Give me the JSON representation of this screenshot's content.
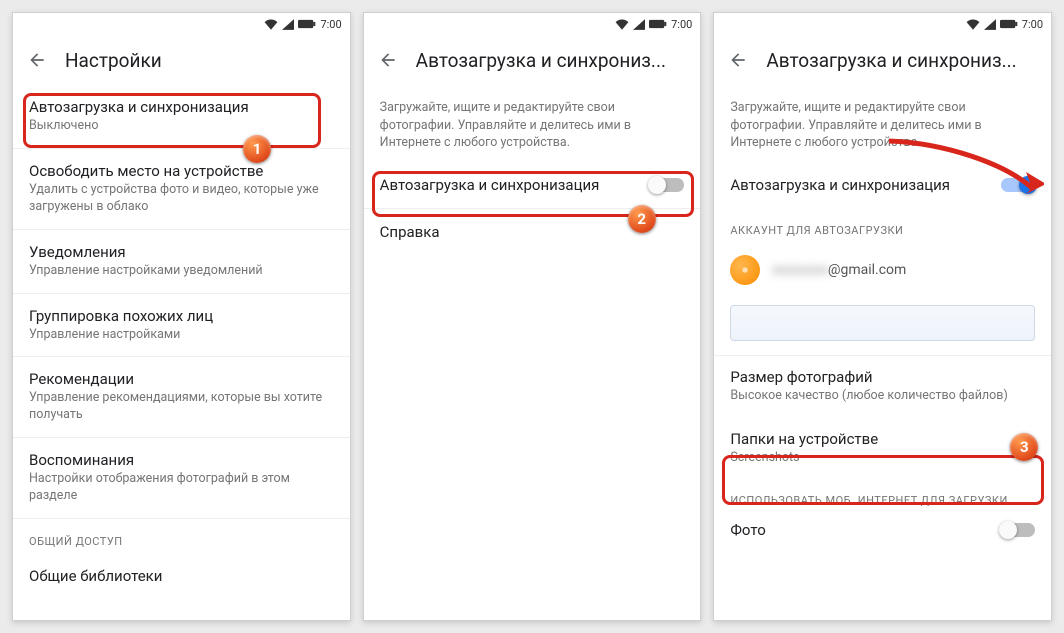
{
  "status": {
    "time": "7:00"
  },
  "screen1": {
    "title": "Настройки",
    "items": [
      {
        "primary": "Автозагрузка и синхронизация",
        "secondary": "Выключено"
      },
      {
        "primary": "Освободить место на устройстве",
        "secondary": "Удалить с устройства фото и видео, которые уже загружены в облако"
      },
      {
        "primary": "Уведомления",
        "secondary": "Управление настройками уведомлений"
      },
      {
        "primary": "Группировка похожих лиц",
        "secondary": "Управление настройками"
      },
      {
        "primary": "Рекомендации",
        "secondary": "Управление рекомендациями, которые вы хотите получать"
      },
      {
        "primary": "Воспоминания",
        "secondary": "Настройки отображения фотографий в этом разделе"
      }
    ],
    "section": "ОБЩИЙ ДОСТУП",
    "shared": "Общие библиотеки"
  },
  "screen2": {
    "title": "Автозагрузка и синхрониз...",
    "description": "Загружайте, ищите и редактируйте свои фотографии. Управляйте и делитесь ими в Интернете с любого устройства.",
    "toggle_label": "Автозагрузка и синхронизация",
    "help": "Справка"
  },
  "screen3": {
    "title": "Автозагрузка и синхрониз...",
    "description": "Загружайте, ищите и редактируйте свои фотографии. Управляйте и делитесь ими в Интернете с любого устройства.",
    "toggle_label": "Автозагрузка и синхронизация",
    "account_section": "АККАУНТ ДЛЯ АВТОЗАГРУЗКИ",
    "account_email_suffix": "@gmail.com",
    "size_title": "Размер фотографий",
    "size_sub": "Высокое качество (любое количество файлов)",
    "folders_title": "Папки на устройстве",
    "folders_sub": "Screenshots",
    "mobile_section": "ИСПОЛЬЗОВАТЬ МОБ. ИНТЕРНЕТ ДЛЯ ЗАГРУЗКИ",
    "mobile_photo": "Фото"
  },
  "badges": {
    "b1": "1",
    "b2": "2",
    "b3": "3"
  }
}
